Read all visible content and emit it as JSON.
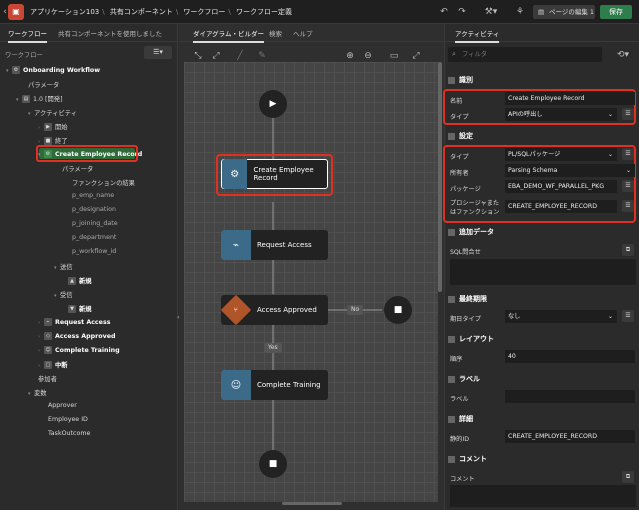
{
  "topbar": {
    "app": "アプリケーション103",
    "shared": "共有コンポーネント",
    "workflow": "ワークフロー",
    "workflow_def": "ワークフロー定義",
    "edit_page": "ページの編集 1",
    "save": "保存"
  },
  "left": {
    "tab_workflow": "ワークフロー",
    "tab_shared": "共有コンポーネントを使用しました",
    "root_label": "ワークフロー",
    "tree": {
      "onboarding": "Onboarding Workflow",
      "params": "パラメータ",
      "version": "1.0 [開発]",
      "activities": "アクティビティ",
      "start": "開始",
      "end": "終了",
      "create_emp": "Create Employee Record",
      "sub_params": "パラメータ",
      "func_result": "ファンクションの結果",
      "p1": "p_emp_name",
      "p2": "p_designation",
      "p3": "p_joining_date",
      "p4": "p_department",
      "p5": "p_workflow_id",
      "send": "送信",
      "new1": "新規",
      "receive": "受信",
      "new2": "新規",
      "req_access": "Request Access",
      "acc_approved": "Access Approved",
      "complete_training": "Complete Training",
      "interrupt": "中断",
      "participants": "参加者",
      "variables": "変数",
      "v1": "Approver",
      "v2": "Employee ID",
      "v3": "TaskOutcome"
    }
  },
  "center": {
    "tab_diagram": "ダイアグラム・ビルダー",
    "tab_search": "検索",
    "tab_help": "ヘルプ",
    "nodes": {
      "create": "Create Employee Record",
      "request": "Request Access",
      "approved": "Access Approved",
      "training": "Complete Training"
    },
    "no_label": "No",
    "yes_label": "Yes"
  },
  "right": {
    "tab_activity": "アクティビティ",
    "filter_placeholder": "フィルタ",
    "sec_id": "識別",
    "name_label": "名前",
    "name_value": "Create Employee Record",
    "type_label": "タイプ",
    "type_value": "APIの呼出し",
    "sec_settings": "設定",
    "s_type_label": "タイプ",
    "s_type_value": "PL/SQLパッケージ",
    "owner_label": "所有者",
    "owner_value": "Parsing Schema",
    "pkg_label": "パッケージ",
    "pkg_value": "EBA_DEMO_WF_PARALLEL_PKG",
    "proc_label_1": "プロシージャまた",
    "proc_label_2": "はファンクション",
    "proc_value": "CREATE_EMPLOYEE_RECORD",
    "sec_extra": "追加データ",
    "sql_label": "SQL問合せ",
    "sec_deadline": "最終期限",
    "due_label": "期日タイプ",
    "due_value": "なし",
    "sec_layout": "レイアウト",
    "seq_label": "順序",
    "seq_value": "40",
    "sec_label": "ラベル",
    "label_label": "ラベル",
    "sec_advanced": "詳細",
    "static_label": "静的ID",
    "static_value": "CREATE_EMPLOYEE_RECORD",
    "sec_comment": "コメント",
    "comment_label": "コメント"
  }
}
